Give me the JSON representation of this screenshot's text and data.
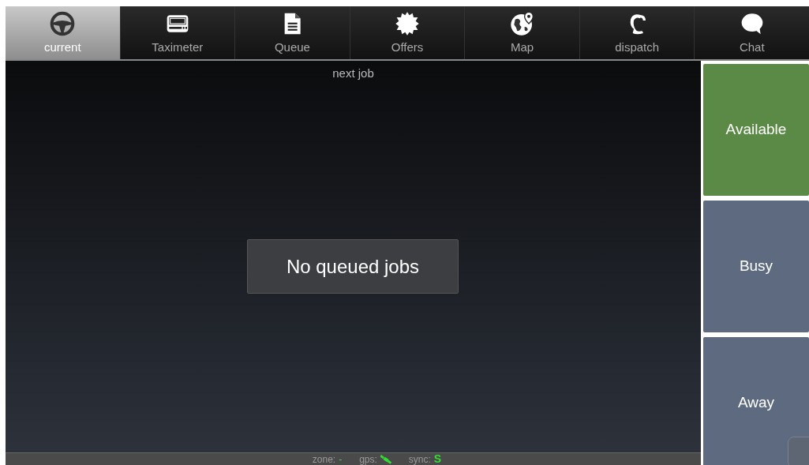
{
  "tabs": [
    {
      "label": "current",
      "selected": true
    },
    {
      "label": "Taximeter",
      "selected": false
    },
    {
      "label": "Queue",
      "selected": false
    },
    {
      "label": "Offers",
      "selected": false
    },
    {
      "label": "Map",
      "selected": false
    },
    {
      "label": "dispatch",
      "selected": false
    },
    {
      "label": "Chat",
      "selected": false
    }
  ],
  "main": {
    "header": "next job",
    "message": "No queued jobs"
  },
  "status_buttons": [
    {
      "label": "Available",
      "selected": true
    },
    {
      "label": "Busy",
      "selected": false
    },
    {
      "label": "Away",
      "selected": false
    }
  ],
  "status_bar": {
    "zone_label": "zone:",
    "zone_value": "-",
    "gps_label": "gps:",
    "sync_label": "sync:",
    "sync_value": "S"
  }
}
